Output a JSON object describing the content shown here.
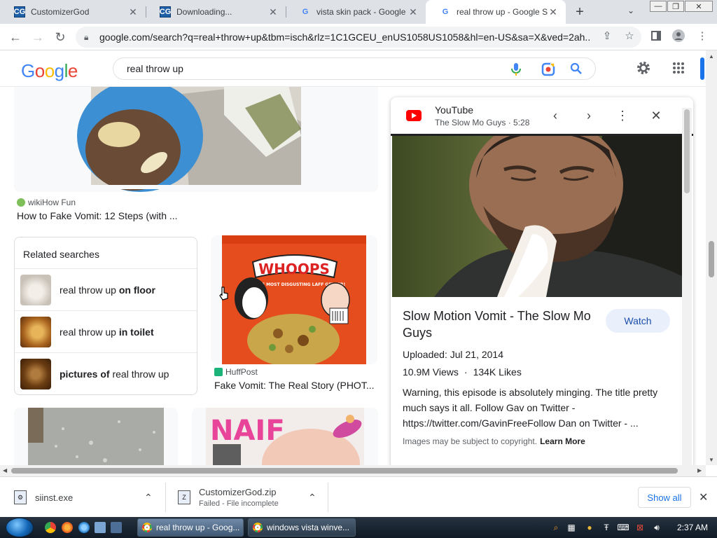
{
  "browser": {
    "tabs": [
      {
        "title": "CustomizerGod",
        "active": false
      },
      {
        "title": "Downloading...",
        "active": false
      },
      {
        "title": "vista skin pack - Google Se",
        "active": false
      },
      {
        "title": "real throw up - Google Se",
        "active": true
      }
    ],
    "new_tab_symbol": "+",
    "url": "google.com/search?q=real+throw+up&tbm=isch&rlz=1C1GCEU_enUS1058US1058&hl=en-US&sa=X&ved=2ah..."
  },
  "google": {
    "logo": "Google",
    "query": "real throw up"
  },
  "results": {
    "first": {
      "source": "wikiHow Fun",
      "caption": "How to Fake Vomit: 12 Steps (with ..."
    },
    "related": {
      "header": "Related searches",
      "items": [
        {
          "prefix": "real throw up ",
          "bold": "on floor",
          "suffix": ""
        },
        {
          "prefix": "real throw up ",
          "bold": "in toilet",
          "suffix": ""
        },
        {
          "prefix": "",
          "bold": "pictures of",
          "suffix": " real throw up"
        }
      ]
    },
    "second": {
      "source": "HuffPost",
      "caption": "Fake Vomit: The Real Story (PHOT...",
      "box_top_text": "WHOOPS",
      "box_tag": "THE MOST DISGUSTING LAFF GETTER!"
    },
    "naif_text": "NAIF"
  },
  "panel": {
    "site": "YouTube",
    "channel_line": "The Slow Mo Guys · 5:28",
    "title": "Slow Motion Vomit - The Slow Mo Guys",
    "watch_label": "Watch",
    "uploaded": "Uploaded: Jul 21, 2014",
    "views": "10.9M Views",
    "likes": "134K Likes",
    "description": "Warning, this episode is absolutely minging. The title pretty much says it all. Follow Gav on Twitter - https://twitter.com/GavinFreeFollow Dan on Twitter - ...",
    "copyright": "Images may be subject to copyright.",
    "learn_more": "Learn More"
  },
  "downloads": {
    "items": [
      {
        "name": "siinst.exe",
        "status": ""
      },
      {
        "name": "CustomizerGod.zip",
        "status": "Failed - File incomplete"
      }
    ],
    "show_all": "Show all"
  },
  "taskbar": {
    "items": [
      {
        "label": "real throw up - Goog...",
        "active": true
      },
      {
        "label": "windows vista winve...",
        "active": false
      }
    ],
    "clock": "2:37 AM"
  }
}
